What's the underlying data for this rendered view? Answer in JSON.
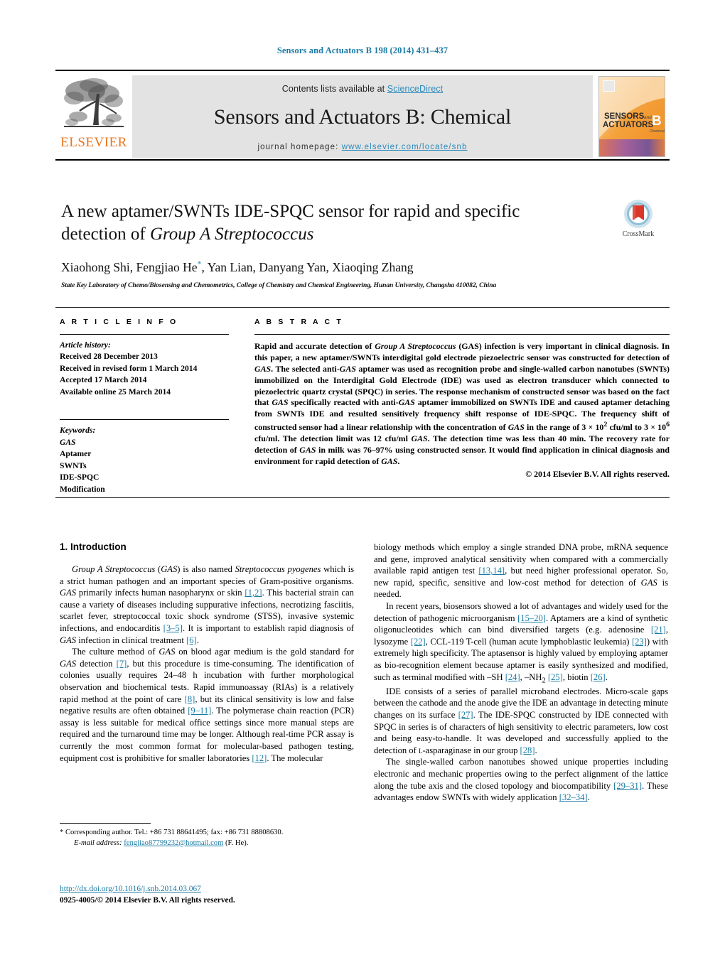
{
  "running_head": "Sensors and Actuators B 198 (2014) 431–437",
  "masthead": {
    "contents_prefix": "Contents lists available at ",
    "sciencedirect": "ScienceDirect",
    "journal_title": "Sensors and Actuators B: Chemical",
    "homepage_label": "journal homepage:",
    "homepage_url": "www.elsevier.com/locate/snb",
    "publisher": "ELSEVIER",
    "cover_line1": "SENSORS",
    "cover_and": "and",
    "cover_line2": "ACTUATORS",
    "cover_letter": "B",
    "cover_sub": "Chemical",
    "accent_blue": "#2b8bbd",
    "elsevier_orange": "#E87722",
    "band_grey": "#e3e3e3"
  },
  "article": {
    "title_line1": "A new aptamer/SWNTs IDE-SPQC sensor for rapid and specific",
    "title_line2_prefix": "detection of ",
    "title_line2_italic": "Group A Streptococcus",
    "authors": "Xiaohong Shi, Fengjiao He",
    "authors_rest": ", Yan Lian, Danyang Yan, Xiaoqing Zhang",
    "corresponding_mark": "*",
    "affiliation": "State Key Laboratory of Chemo/Biosensing and Chemometrics, College of Chemistry and Chemical Engineering, Hunan University, Changsha 410082, China",
    "crossmark_label": "CrossMark"
  },
  "article_info": {
    "heading": "A R T I C L E   I N F O",
    "history_label": "Article history:",
    "history": [
      "Received 28 December 2013",
      "Received in revised form 1 March 2014",
      "Accepted 17 March 2014",
      "Available online 25 March 2014"
    ],
    "keywords_label": "Keywords:",
    "keywords": [
      "GAS",
      "Aptamer",
      "SWNTs",
      "IDE-SPQC",
      "Modification"
    ]
  },
  "abstract": {
    "heading": "A B S T R A C T",
    "p1_a": "Rapid and accurate detection of ",
    "p1_it1": "Group A Streptococcus",
    "p1_b": " (GAS) infection is very important in clinical diagnosis. In this paper, a new aptamer/SWNTs interdigital gold electrode piezoelectric sensor was constructed for detection of ",
    "p1_it2": "GAS",
    "p1_c": ". The selected anti-",
    "p1_it3": "GAS",
    "p1_d": " aptamer was used as recognition probe and single-walled carbon nanotubes (SWNTs) immobilized on the Interdigital Gold Electrode (IDE) was used as electron transducer which connected to piezoelectric quartz crystal (SPQC) in series. The response mechanism of constructed sensor was based on the fact that ",
    "p1_it4": "GAS",
    "p1_e": " specifically reacted with anti-",
    "p1_it5": "GAS",
    "p1_f": " aptamer immobilized on SWNTs IDE and caused aptamer detaching from SWNTs IDE and resulted sensitively frequency shift response of IDE-SPQC. The frequency shift of constructed sensor had a linear relationship with the concentration of ",
    "p1_it6": "GAS",
    "p1_g": " in the range of 3 × 10",
    "p1_sup1": "2",
    "p1_h": " cfu/ml to 3 × 10",
    "p1_sup2": "6",
    "p1_i": " cfu/ml. The detection limit was 12 cfu/ml ",
    "p1_it7": "GAS",
    "p1_j": ". The detection time was less than 40 min. The recovery rate for detection of ",
    "p1_it8": "GAS",
    "p1_k": " in milk was 76–97% using constructed sensor. It would find application in clinical diagnosis and environment for rapid detection of ",
    "p1_it9": "GAS",
    "p1_l": ".",
    "copyright": "© 2014 Elsevier B.V. All rights reserved."
  },
  "introduction": {
    "heading": "1.  Introduction",
    "left": {
      "p1_it1": "Group A Streptococcus",
      "p1_a": " (",
      "p1_it2": "GAS",
      "p1_b": ") is also named ",
      "p1_it3": "Streptococcus pyogenes",
      "p1_c": " which is a strict human pathogen and an important species of Gram-positive organisms. ",
      "p1_it4": "GAS",
      "p1_d": " primarily infects human nasopharynx or skin ",
      "p1_r1": "[1,2]",
      "p1_e": ". This bacterial strain can cause a variety of diseases including suppurative infections, necrotizing fasciitis, scarlet fever, streptococcal toxic shock syndrome (STSS), invasive systemic infections, and endocarditis ",
      "p1_r2": "[3–5]",
      "p1_f": ". It is important to establish rapid diagnosis of ",
      "p1_it5": "GAS",
      "p1_g": " infection in clinical treatment ",
      "p1_r3": "[6]",
      "p1_h": ".",
      "p2_a": "The culture method of ",
      "p2_it1": "GAS",
      "p2_b": " on blood agar medium is the gold standard for ",
      "p2_it2": "GAS",
      "p2_c": " detection ",
      "p2_r1": "[7]",
      "p2_d": ", but this procedure is time-consuming. The identification of colonies usually requires 24–48 h incubation with further morphological observation and biochemical tests. Rapid immunoassay (RIAs) is a relatively rapid method at the point of care ",
      "p2_r2": "[8]",
      "p2_e": ", but its clinical sensitivity is low and false negative results are often obtained ",
      "p2_r3": "[9–11]",
      "p2_f": ". The polymerase chain reaction (PCR) assay is less suitable for medical office settings since more manual steps are required and the turnaround time may be longer. Although real-time PCR assay is currently the most common format for molecular-based pathogen testing, equipment cost is prohibitive for smaller laboratories ",
      "p2_r4": "[12]",
      "p2_g": ". The molecular"
    },
    "right": {
      "p2_cont_a": "biology methods which employ a single stranded DNA probe, mRNA sequence and gene, improved analytical sensitivity when compared with a commercially available rapid antigen test ",
      "p2_cont_r": "[13,14]",
      "p2_cont_b": ", but need higher professional operator. So, new rapid, specific, sensitive and low-cost method for detection of ",
      "p2_cont_it": "GAS",
      "p2_cont_c": " is needed.",
      "p3_a": "In recent years, biosensors showed a lot of advantages and widely used for the detection of pathogenic microorganism ",
      "p3_r1": "[15–20]",
      "p3_b": ". Aptamers are a kind of synthetic oligonucleotides which can bind diversified targets (e.g. adenosine ",
      "p3_r2": "[21]",
      "p3_c": ", lysozyme ",
      "p3_r3": "[22]",
      "p3_d": ", CCL-119 T-cell (human acute lymphoblastic leukemia) ",
      "p3_r4": "[23]",
      "p3_e": ") with extremely high specificity. The aptasensor is highly valued by employing aptamer as bio-recognition element because aptamer is easily synthesized and modified, such as terminal modified with –SH ",
      "p3_r5": "[24]",
      "p3_f": ", –NH",
      "p3_sub": "2",
      "p3_g": " ",
      "p3_r6": "[25]",
      "p3_h": ", biotin ",
      "p3_r7": "[26]",
      "p3_i": ".",
      "p4_a": "IDE consists of a series of parallel microband electrodes. Micro-scale gaps between the cathode and the anode give the IDE an advantage in detecting minute changes on its surface ",
      "p4_r1": "[27]",
      "p4_b": ". The IDE-SPQC constructed by IDE connected with SPQC in series is of characters of high sensitivity to electric parameters, low cost and being easy-to-handle. It was developed and successfully applied to the detection of ",
      "p4_sc": "l",
      "p4_c": "-asparaginase in our group ",
      "p4_r2": "[28]",
      "p4_d": ".",
      "p5_a": "The single-walled carbon nanotubes showed unique properties including electronic and mechanic properties owing to the perfect alignment of the lattice along the tube axis and the closed topology and biocompatibility ",
      "p5_r1": "[29–31]",
      "p5_b": ". These advantages endow SWNTs with widely application ",
      "p5_r2": "[32–34]",
      "p5_c": "."
    }
  },
  "footnotes": {
    "star": "*",
    "corresponding": " Corresponding author. Tel.: +86 731 88641495; fax: +86 731 88808630.",
    "email_label": "E-mail address:",
    "email": "fengjiao87799232@hotmail.com",
    "email_suffix": " (F. He).",
    "doi": "http://dx.doi.org/10.1016/j.snb.2014.03.067",
    "issn": "0925-4005/© 2014 Elsevier B.V. All rights reserved."
  }
}
